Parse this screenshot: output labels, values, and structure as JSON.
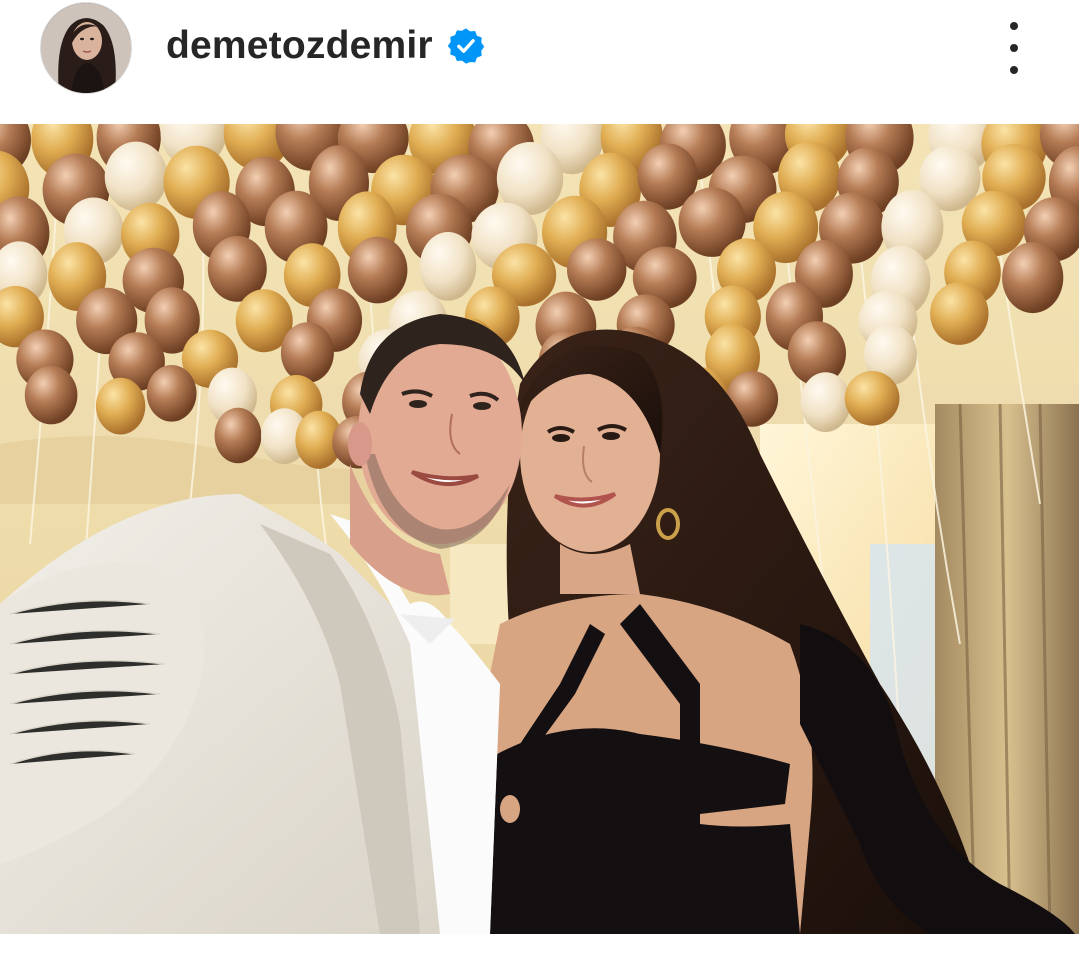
{
  "header": {
    "username": "demetozdemir",
    "verified": true,
    "avatar_icon": "profile-avatar",
    "more_icon": "more-options-vertical-icon"
  },
  "photo": {
    "subject": "post-image"
  },
  "colors": {
    "text": "#262626",
    "verified_blue": "#0095f6",
    "balloon_gold": "#d9a64b",
    "balloon_bronze": "#b07a50",
    "balloon_white": "#f3e6cf"
  }
}
